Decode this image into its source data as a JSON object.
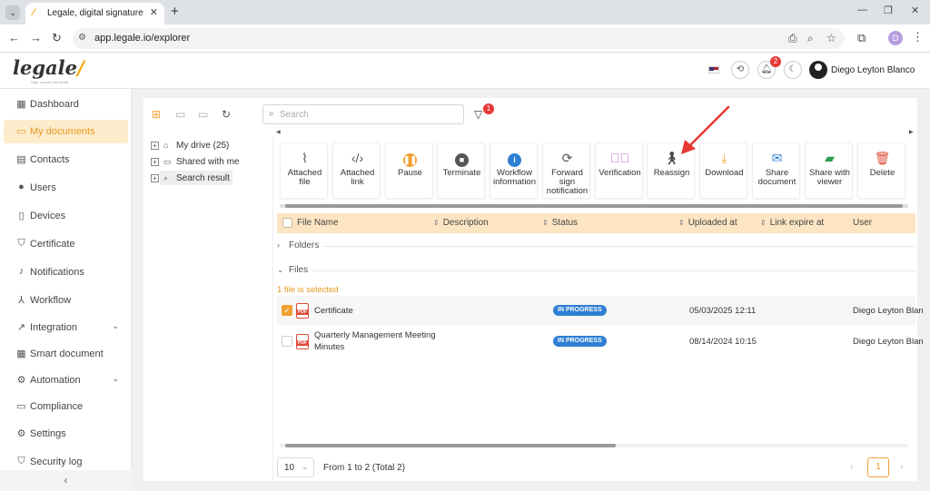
{
  "browser": {
    "tab_title": "Legale, digital signature",
    "url": "app.legale.io/explorer",
    "profile_initial": "D"
  },
  "header": {
    "logo_text": "legale",
    "logo_tagline": "Sign, secure and smart",
    "notification_count": "2",
    "user_name": "Diego Leyton Blanco"
  },
  "sidebar": {
    "items": [
      {
        "label": "Dashboard",
        "icon": "dashboard-icon"
      },
      {
        "label": "My documents",
        "icon": "folder-icon"
      },
      {
        "label": "Contacts",
        "icon": "contacts-icon"
      },
      {
        "label": "Users",
        "icon": "user-icon"
      },
      {
        "label": "Devices",
        "icon": "device-icon"
      },
      {
        "label": "Certificate",
        "icon": "shield-icon"
      },
      {
        "label": "Notifications",
        "icon": "bell-icon"
      },
      {
        "label": "Workflow",
        "icon": "workflow-icon"
      },
      {
        "label": "Integration",
        "icon": "integration-icon"
      },
      {
        "label": "Smart document",
        "icon": "smart-document-icon"
      },
      {
        "label": "Automation",
        "icon": "automation-icon"
      },
      {
        "label": "Compliance",
        "icon": "compliance-icon"
      },
      {
        "label": "Settings",
        "icon": "gear-icon"
      },
      {
        "label": "Security log",
        "icon": "security-log-icon"
      }
    ],
    "active_index": 1,
    "collapse_glyph": "‹"
  },
  "explorer": {
    "search_placeholder": "Search",
    "filter_count": "1",
    "tree": [
      {
        "label": "My drive (25)",
        "icon": "drive-icon"
      },
      {
        "label": "Shared with me",
        "icon": "folder-icon"
      },
      {
        "label": "Search result",
        "icon": "search-icon"
      }
    ],
    "actions": [
      {
        "label": "Attached file",
        "icon": "paperclip-icon",
        "color": "#555555"
      },
      {
        "label": "Attached link",
        "icon": "code-icon",
        "color": "#555555"
      },
      {
        "label": "Pause",
        "icon": "pause-icon",
        "color": "#f0a030"
      },
      {
        "label": "Terminate",
        "icon": "stop-icon",
        "color": "#555555"
      },
      {
        "label": "Workflow information",
        "icon": "info-icon",
        "color": "#2d7fd3"
      },
      {
        "label": "Forward sign notification",
        "icon": "refresh-icon",
        "color": "#555555"
      },
      {
        "label": "Verification",
        "icon": "check-circle-icon",
        "color": "#c266c9"
      },
      {
        "label": "Reassign",
        "icon": "reassign-icon",
        "color": "#555555"
      },
      {
        "label": "Download",
        "icon": "download-icon",
        "color": "#f0a030"
      },
      {
        "label": "Share document",
        "icon": "mail-icon",
        "color": "#2d7fd3"
      },
      {
        "label": "Share with viewer",
        "icon": "share-folder-icon",
        "color": "#2e9e4f"
      },
      {
        "label": "Delete",
        "icon": "trash-icon",
        "color": "#e04a3a"
      }
    ],
    "columns": [
      "File Name",
      "Description",
      "Status",
      "Uploaded at",
      "Link expire at",
      "User"
    ],
    "group_folders": "Folders",
    "group_files": "Files",
    "selection_note": "1 file is selected",
    "rows": [
      {
        "name": "Certificate",
        "status": "IN PROGRESS",
        "uploaded": "05/03/2025 12:11",
        "user": "Diego Leyton Blan",
        "checked": true
      },
      {
        "name_line1": "Quarterly Management Meeting",
        "name_line2": "Minutes",
        "status": "IN PROGRESS",
        "uploaded": "08/14/2024 10:15",
        "user": "Diego Leyton Blan",
        "checked": false
      }
    ],
    "file_type": "PDF",
    "page_size": "10",
    "range_text": "From 1 to 2 (Total 2)",
    "current_page": "1"
  },
  "colors": {
    "accent": "#f0a030",
    "status_badge": "#2d7fd3",
    "annotation_arrow": "#e53935"
  }
}
